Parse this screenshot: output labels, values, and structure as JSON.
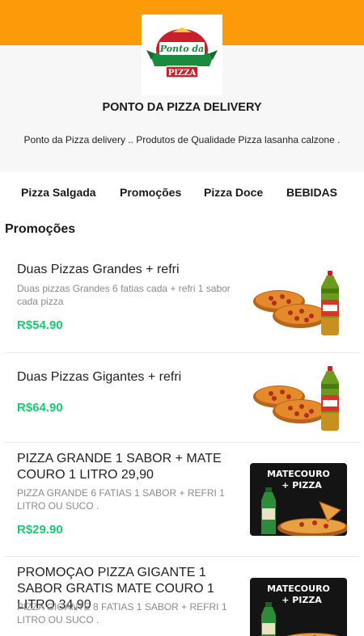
{
  "store": {
    "name": "PONTO DA PIZZA DELIVERY",
    "description": "Ponto da Pizza delivery .. Produtos de Qualidade Pizza lasanha calzone .",
    "logo_text_top": "Ponto da",
    "logo_text_bottom": "PIZZA"
  },
  "categories": [
    {
      "label": "Pizza Salgada"
    },
    {
      "label": "Promoções"
    },
    {
      "label": "Pizza Doce"
    },
    {
      "label": "BEBIDAS"
    }
  ],
  "section": {
    "title": "Promoções"
  },
  "products": [
    {
      "name": "Duas Pizzas Grandes + refri",
      "description": "Duas pizzas Grandes 6 fatias cada + refri 1 sabor cada pizza",
      "price": "R$54.90",
      "image": "two-pizzas-soda"
    },
    {
      "name": "Duas Pizzas Gigantes + refri",
      "description": "",
      "price": "R$64.90",
      "image": "two-pizzas-soda"
    },
    {
      "name": "PIZZA GRANDE 1 SABOR + MATE COURO 1 LITRO 29,90",
      "description": "PIZZA GRANDE 6 FATIAS 1 SABOR + REFRI 1 LITRO OU SUCO .",
      "price": "R$29.90",
      "image": "mate-couro-banner",
      "banner_line1": "MATECOURO",
      "banner_line2": "+ PIZZA"
    },
    {
      "name": "PROMOÇAO PIZZA GIGANTE 1 SABOR GRATIS MATE COURO 1 LITRO 34,90",
      "description": "PIZZA GIGANTE 8 FATIAS 1 SABOR + REFRI 1 LITRO OU SUCO .",
      "price": "",
      "image": "mate-couro-banner",
      "banner_line1": "MATECOURO",
      "banner_line2": "+ PIZZA"
    }
  ],
  "colors": {
    "brand": "#fd9a0a",
    "price": "#1ec773",
    "logo_red": "#c8202a",
    "logo_green": "#1a8a3c"
  }
}
